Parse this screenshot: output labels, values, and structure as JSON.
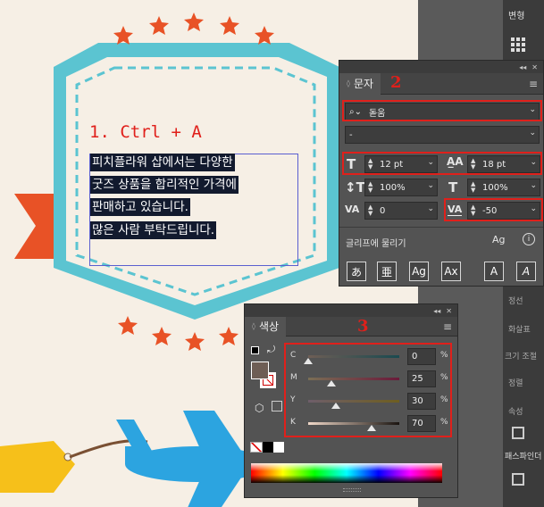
{
  "artwork": {
    "step1_label": "1. Ctrl + A",
    "text_lines": [
      "피치플라워 샵에서는 다양한",
      "굿즈 상품을 합리적인 가격에",
      "판매하고 있습니다.",
      "많은 사람 부탁드립니다."
    ]
  },
  "annotations": {
    "step2": "2",
    "step3": "3"
  },
  "character_panel": {
    "tab_label": "문자",
    "font_family": "돋움",
    "font_style": "-",
    "font_size": "12 pt",
    "leading": "18 pt",
    "vertical_scale": "100%",
    "horizontal_scale": "100%",
    "kerning": "0",
    "tracking": "-50",
    "snap_label": "글리프에 물리기",
    "glyph_buttons": [
      "あ",
      "亜",
      "Ag",
      "Ax",
      "A",
      "A"
    ]
  },
  "color_panel": {
    "tab_label": "색상",
    "channels": [
      {
        "label": "C",
        "value": "0",
        "pct": "%",
        "level": 0
      },
      {
        "label": "M",
        "value": "25",
        "pct": "%",
        "level": 25
      },
      {
        "label": "Y",
        "value": "30",
        "pct": "%",
        "level": 30
      },
      {
        "label": "K",
        "value": "70",
        "pct": "%",
        "level": 70
      }
    ],
    "fill_color": "#6e5e55"
  },
  "right_panel": {
    "title": "변형",
    "items": [
      "정선",
      "화살표",
      "크기 조절",
      "정렬",
      "속성",
      "패스파인더"
    ]
  },
  "colors": {
    "accent_red": "#e0201b",
    "badge_cyan": "#5bc4d1",
    "ribbon_orange": "#e85226",
    "plane_blue": "#2ca4e0"
  }
}
